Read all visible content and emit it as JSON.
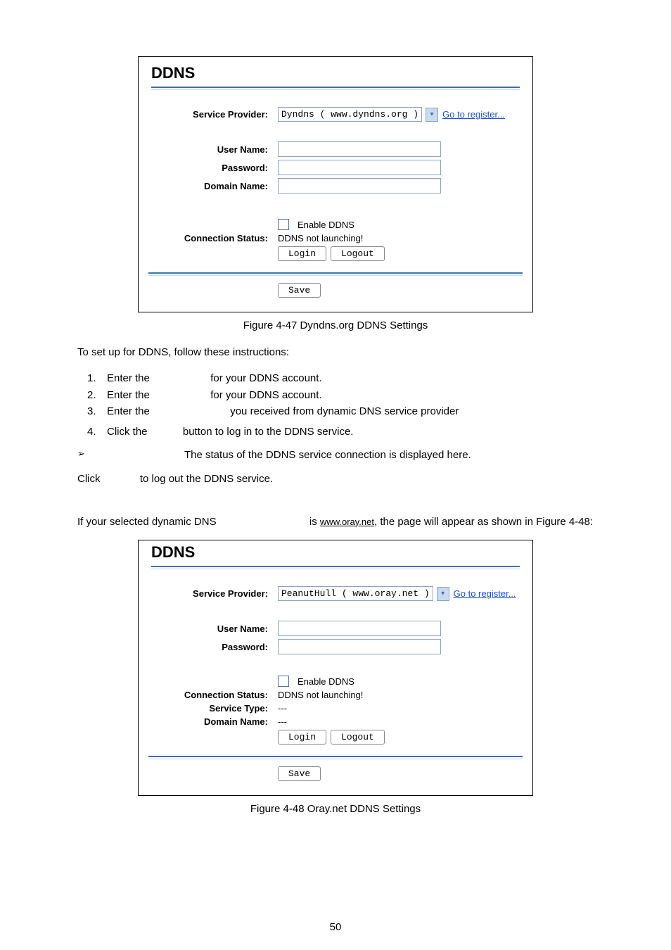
{
  "page_number": "50",
  "fig47": {
    "title": "DDNS",
    "labels": {
      "service_provider": "Service Provider:",
      "user_name": "User Name:",
      "password": "Password:",
      "domain_name": "Domain Name:",
      "connection_status": "Connection Status:"
    },
    "service_provider_value": "Dyndns ( www.dyndns.org )",
    "register_link": "Go to register...",
    "enable_ddns": "Enable DDNS",
    "status_text": "DDNS not launching!",
    "login_btn": "Login",
    "logout_btn": "Logout",
    "save_btn": "Save",
    "caption": "Figure 4-47 Dyndns.org DDNS Settings"
  },
  "instructions": {
    "lead": "To set up for DDNS, follow these instructions:",
    "items": [
      {
        "n": "1.",
        "a": "Enter the ",
        "b": " for your DDNS account."
      },
      {
        "n": "2.",
        "a": "Enter the ",
        "b": " for your DDNS account."
      },
      {
        "n": "3.",
        "a": "Enter the ",
        "b": " you received from dynamic DNS service provider"
      },
      {
        "n": "4.",
        "a": "Click the ",
        "b": " button to log in to the DDNS service."
      }
    ],
    "conn_status_line": "The status of the DDNS service connection is displayed here.",
    "logout_line_a": "Click ",
    "logout_line_b": " to log out the DDNS service."
  },
  "oray_intro": {
    "a": "If your selected dynamic DNS ",
    "b": " is ",
    "link": "www.oray.net",
    "c": ", the page will appear as shown in Figure 4-48:"
  },
  "fig48": {
    "title": "DDNS",
    "labels": {
      "service_provider": "Service Provider:",
      "user_name": "User Name:",
      "password": "Password:",
      "connection_status": "Connection Status:",
      "service_type": "Service Type:",
      "domain_name": "Domain Name:"
    },
    "service_provider_value": "PeanutHull ( www.oray.net )",
    "register_link": "Go to register...",
    "enable_ddns": "Enable DDNS",
    "status_text": "DDNS not launching!",
    "service_type_value": "---",
    "domain_name_value": "---",
    "login_btn": "Login",
    "logout_btn": "Logout",
    "save_btn": "Save",
    "caption": "Figure 4-48 Oray.net DDNS Settings"
  }
}
